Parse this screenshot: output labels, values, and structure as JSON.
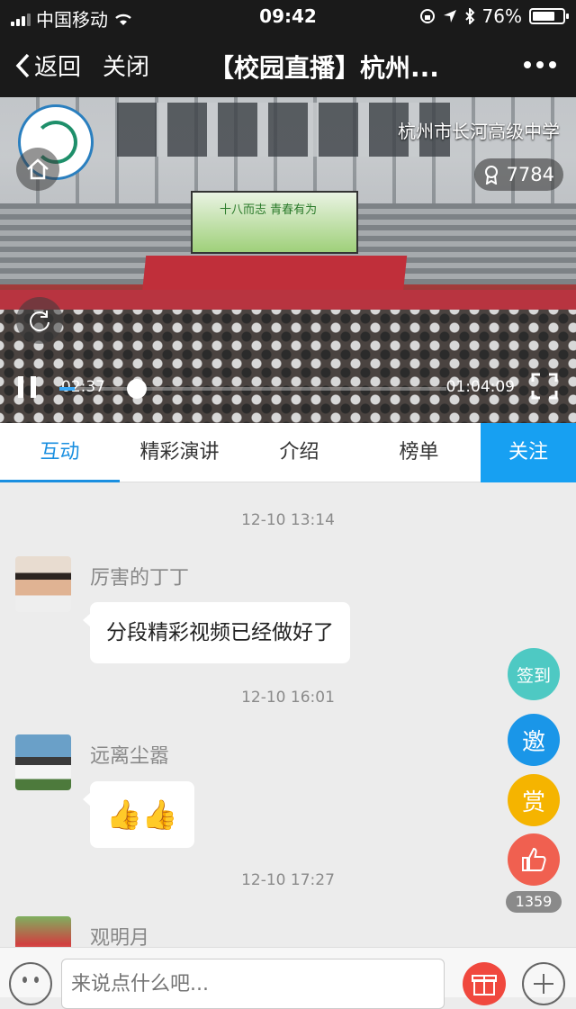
{
  "status_bar": {
    "carrier": "中国移动",
    "time": "09:42",
    "battery": "76%",
    "battery_level": 0.76
  },
  "nav": {
    "back_label": "返回",
    "close_label": "关闭",
    "title": "【校园直播】杭州..."
  },
  "video": {
    "channel_name": "杭州市长河高级中学",
    "viewers": "7784",
    "screen_text": "十八而志 青春有为",
    "current_time": "02:37",
    "total_time": "01:04:09",
    "progress": 0.04,
    "accent": "#3aa8f5"
  },
  "tabs": [
    {
      "label": "互动",
      "active": true
    },
    {
      "label": "精彩演讲",
      "active": false
    },
    {
      "label": "介绍",
      "active": false
    },
    {
      "label": "榜单",
      "active": false
    }
  ],
  "follow_label": "关注",
  "messages": [
    {
      "time": "12-10 13:14",
      "user": "厉害的丁丁",
      "text": "分段精彩视频已经做好了"
    },
    {
      "time": "12-10 16:01",
      "user": "远离尘嚣",
      "text": "👍👍"
    },
    {
      "time": "12-10 17:27",
      "user": "观明月",
      "text": ""
    }
  ],
  "side_actions": {
    "checkin": {
      "label": "签到",
      "color": "#4ec9c3"
    },
    "invite": {
      "label": "邀",
      "color": "#1a96e8"
    },
    "reward": {
      "label": "赏",
      "color": "#f5b400"
    },
    "like": {
      "color": "#f06050",
      "icon": "thumbs-up-icon"
    }
  },
  "like_count": "1359",
  "input": {
    "placeholder": "来说点什么吧..."
  }
}
